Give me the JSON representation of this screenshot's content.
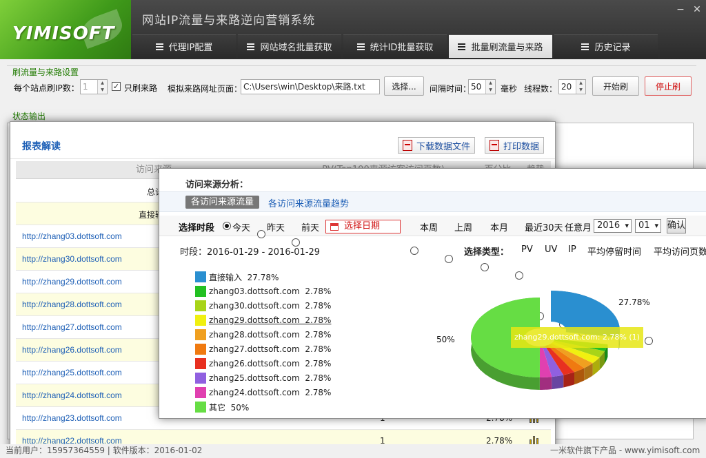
{
  "app": {
    "logo": "YIMISOFT",
    "title": "网站IP流量与来路逆向营销系统"
  },
  "window_controls": {
    "min": "−",
    "close": "✕"
  },
  "tabs": [
    {
      "label": "代理IP配置"
    },
    {
      "label": "网站域名批量获取"
    },
    {
      "label": "统计ID批量获取"
    },
    {
      "label": "批量刷流量与来路",
      "active": true
    },
    {
      "label": "历史记录"
    }
  ],
  "settings": {
    "legend": "刷流量与来路设置",
    "ip_label": "每个站点刷IP数：",
    "ip_value": "1",
    "only_referer_check": "✓",
    "only_referer_label": "只刷来路",
    "referer_page_label": "模拟来路网址页面：",
    "referer_page_value": "C:\\Users\\win\\Desktop\\来路.txt",
    "choose_btn": "选择...",
    "interval_label": "间隔时间：",
    "interval_value": "50",
    "ms_label": "毫秒",
    "threads_label": "线程数：",
    "threads_value": "20",
    "start_btn": "开始刷",
    "stop_btn": "停止刷"
  },
  "status": {
    "legend": "状态输出"
  },
  "report": {
    "title": "报表解读",
    "download_btn": "下载数据文件",
    "print_btn": "打印数据",
    "headers": [
      "访问来源",
      "PV(Top100来源访客访问页数)",
      "百分比",
      "趋势"
    ],
    "total_label": "总计",
    "direct_label": "直接输",
    "rows": [
      {
        "url": "http://zhang03.dottsoft.com",
        "pv": "",
        "pct": ""
      },
      {
        "url": "http://zhang30.dottsoft.com",
        "pv": "",
        "pct": ""
      },
      {
        "url": "http://zhang29.dottsoft.com",
        "pv": "",
        "pct": ""
      },
      {
        "url": "http://zhang28.dottsoft.com",
        "pv": "",
        "pct": ""
      },
      {
        "url": "http://zhang27.dottsoft.com",
        "pv": "",
        "pct": ""
      },
      {
        "url": "http://zhang26.dottsoft.com",
        "pv": "",
        "pct": ""
      },
      {
        "url": "http://zhang25.dottsoft.com",
        "pv": "",
        "pct": ""
      },
      {
        "url": "http://zhang24.dottsoft.com",
        "pv": "",
        "pct": ""
      },
      {
        "url": "http://zhang23.dottsoft.com",
        "pv": "1",
        "pct": "2.78%"
      },
      {
        "url": "http://zhang22.dottsoft.com",
        "pv": "1",
        "pct": "2.78%"
      }
    ]
  },
  "analysis": {
    "title": "访问来源分析：",
    "tab_active": "各访问来源流量",
    "tab_other": "各访问来源流量趋势",
    "filter": {
      "label": "选择时段",
      "options": [
        "今天",
        "昨天",
        "前天"
      ],
      "date_btn": "选择日期",
      "options2": [
        "本周",
        "上周",
        "本月",
        "最近30天"
      ],
      "any_month": "任意月",
      "year": "2016",
      "month": "01",
      "confirm": "确认"
    },
    "period": "时段：2016-01-29 - 2016-01-29",
    "type_label": "选择类型：",
    "types": [
      "PV",
      "UV",
      "IP",
      "平均停留时间",
      "平均访问页数"
    ],
    "tooltip": "zhang29.dottsoft.com: 2.78% (1)",
    "label_top": "27.78%",
    "label_left": "50%"
  },
  "chart_data": {
    "type": "pie",
    "slices": [
      {
        "label": "直接输入",
        "value": 27.78,
        "pct": "27.78%",
        "color": "#2a8fd0"
      },
      {
        "label": "zhang03.dottsoft.com",
        "value": 2.78,
        "pct": "2.78%",
        "color": "#22c022"
      },
      {
        "label": "zhang30.dottsoft.com",
        "value": 2.78,
        "pct": "2.78%",
        "color": "#a8d418"
      },
      {
        "label": "zhang29.dottsoft.com",
        "value": 2.78,
        "pct": "2.78%",
        "color": "#f0f010"
      },
      {
        "label": "zhang28.dottsoft.com",
        "value": 2.78,
        "pct": "2.78%",
        "color": "#f0a020"
      },
      {
        "label": "zhang27.dottsoft.com",
        "value": 2.78,
        "pct": "2.78%",
        "color": "#f07a10"
      },
      {
        "label": "zhang26.dottsoft.com",
        "value": 2.78,
        "pct": "2.78%",
        "color": "#e83020"
      },
      {
        "label": "zhang25.dottsoft.com",
        "value": 2.78,
        "pct": "2.78%",
        "color": "#9060e0"
      },
      {
        "label": "zhang24.dottsoft.com",
        "value": 2.78,
        "pct": "2.78%",
        "color": "#e040b0"
      },
      {
        "label": "其它",
        "value": 50,
        "pct": "50%",
        "color": "#66dd44"
      }
    ]
  },
  "footer": {
    "left": "当前用户：15957364559 | 软件版本：2016-01-02",
    "right": "一米软件旗下产品 - www.yimisoft.com"
  }
}
